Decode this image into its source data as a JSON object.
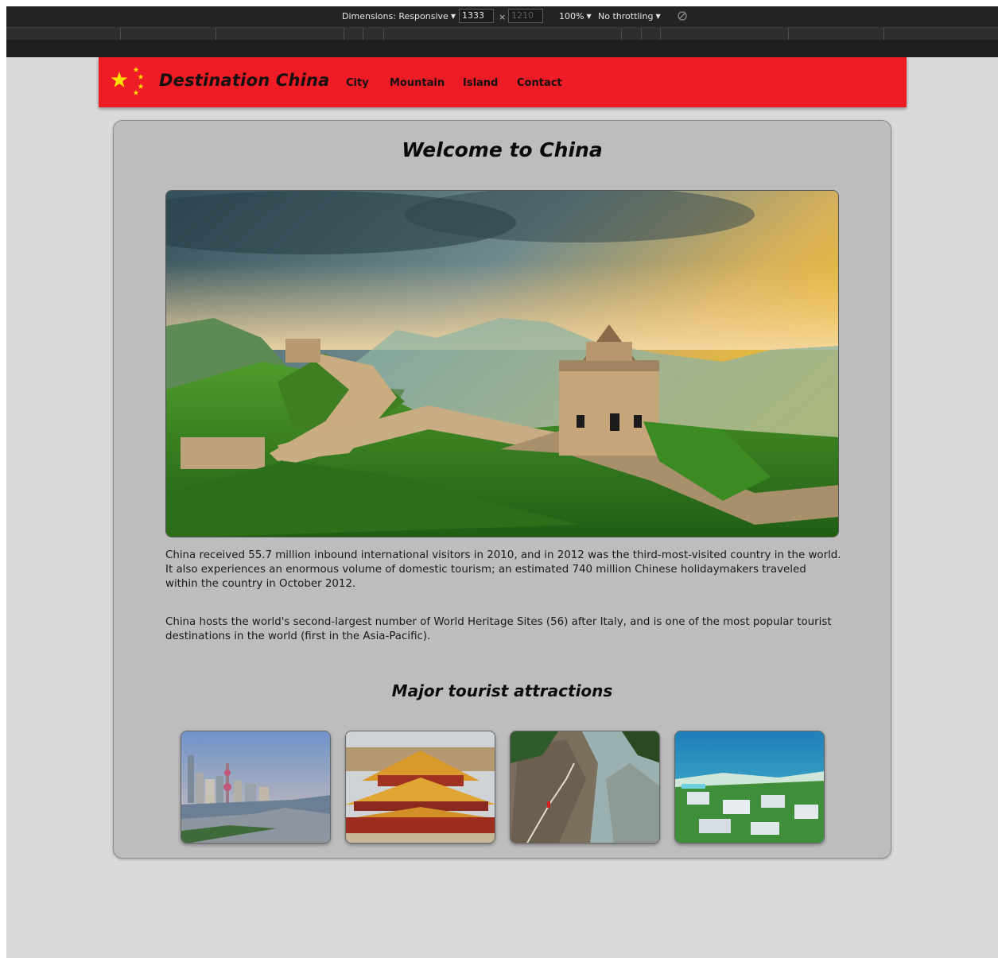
{
  "devtools": {
    "dimensions_label": "Dimensions: Responsive",
    "width_value": "1333",
    "height_value": "1210",
    "times": "×",
    "zoom_label": "100%",
    "throttling_label": "No throttling"
  },
  "navbar": {
    "brand": "Destination China",
    "links": [
      "City",
      "Mountain",
      "Island",
      "Contact"
    ],
    "flag_colors": {
      "red": "#ee1c25",
      "star": "#ffde00"
    }
  },
  "main": {
    "title": "Welcome to China",
    "hero_image": "great-wall-of-china",
    "paragraphs": [
      "China received 55.7 million inbound international visitors in 2010, and in 2012 was the third-most-visited country in the world. It also experiences an enormous volume of domestic tourism; an estimated 740 million Chinese holidaymakers traveled within the country in October 2012.",
      "China hosts the world's second-largest number of World Heritage Sites (56) after Italy, and is one of the most popular tourist destinations in the world (first in the Asia-Pacific)."
    ],
    "attractions_title": "Major tourist attractions",
    "attractions": [
      "shanghai-skyline",
      "forbidden-city",
      "mountain-cliff-path",
      "island-resort"
    ]
  }
}
